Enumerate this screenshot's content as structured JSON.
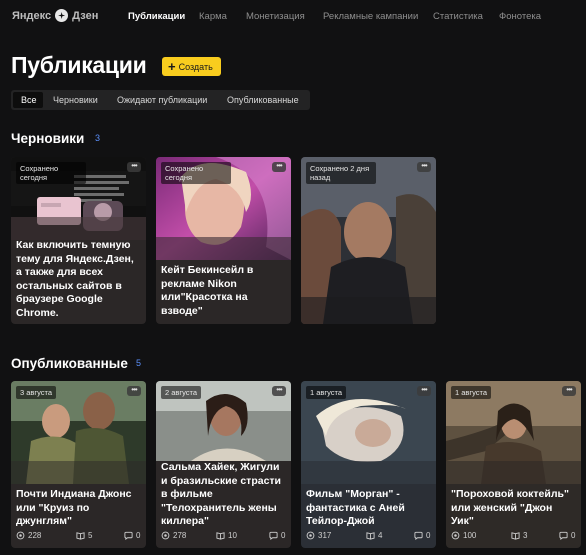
{
  "app": {
    "logo_text": "Яндекс",
    "logo_suffix": "Дзен"
  },
  "nav": [
    "Публикации",
    "Карма",
    "Монетизация",
    "Рекламные кампании",
    "Статистика",
    "Фонотека"
  ],
  "header": {
    "title": "Публикации",
    "create_label": "Создать"
  },
  "filters": [
    "Все",
    "Черновики",
    "Ожидают публикации",
    "Опубликованные"
  ],
  "drafts": {
    "title": "Черновики",
    "count": "3",
    "cards": [
      {
        "badge": "Сохранено сегодня",
        "title": "Как включить темную тему для Яндекс.Дзен, а также для всех остальных сайтов в браузере Google Chrome."
      },
      {
        "badge": "Сохранено сегодня",
        "title": "Кейт Бекинсейл в рекламе Nikon или\"Красотка на взводе\""
      },
      {
        "badge": "Сохранено 2 дня назад",
        "title": ""
      }
    ]
  },
  "published": {
    "title": "Опубликованные",
    "count": "5",
    "cards": [
      {
        "badge": "3 августа",
        "title": "Почти Индиана Джонс или \"Круиз по джунглям\"",
        "views": "228",
        "reads": "5",
        "comments": "0"
      },
      {
        "badge": "2 августа",
        "title": "Сальма Хайек, Жигули и бразильские страсти в фильме \"Телохранитель жены киллера\"",
        "views": "278",
        "reads": "10",
        "comments": "0"
      },
      {
        "badge": "1 августа",
        "title": "Фильм \"Морган\" - фантастика с Аней Тейлор-Джой",
        "views": "317",
        "reads": "4",
        "comments": "0"
      },
      {
        "badge": "1 августа",
        "title": "\"Пороховой коктейль\" или женский \"Джон Уик\"",
        "views": "100",
        "reads": "3",
        "comments": "0"
      }
    ]
  },
  "colors": {
    "accent": "#f9cd1e",
    "count": "#5b8ff9",
    "bg": "#111112"
  },
  "icons": {
    "views": "eye-icon",
    "reads": "book-icon",
    "comments": "comment-icon",
    "more": "more-dots-icon",
    "create": "plus-icon"
  }
}
